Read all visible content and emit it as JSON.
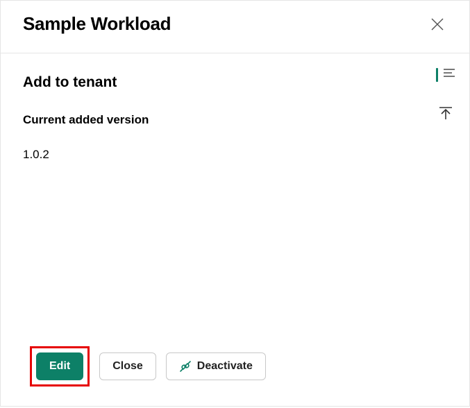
{
  "header": {
    "title": "Sample Workload"
  },
  "main": {
    "section_title": "Add to tenant",
    "version_label": "Current added version",
    "version_value": "1.0.2"
  },
  "footer": {
    "edit_label": "Edit",
    "close_label": "Close",
    "deactivate_label": "Deactivate"
  }
}
